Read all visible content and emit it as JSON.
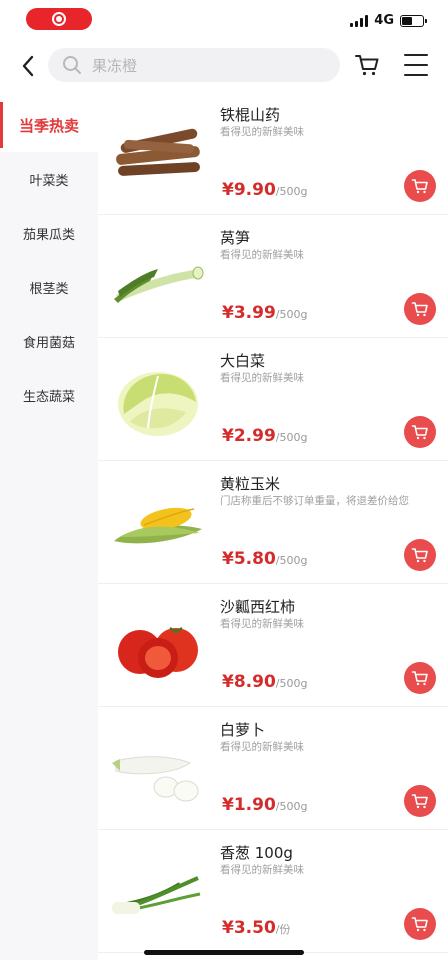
{
  "status_bar": {
    "network": "4G",
    "battery_level": 0.5,
    "colors": {
      "record": "#e8252a"
    }
  },
  "header": {
    "back_icon": "chevron-left-icon",
    "search_placeholder": "果冻橙",
    "cart_icon": "cart-icon",
    "menu_icon": "hamburger-menu-icon"
  },
  "sidebar": {
    "accent_color": "#e23a3a",
    "items": [
      {
        "label": "当季热卖",
        "active": true
      },
      {
        "label": "叶菜类",
        "active": false
      },
      {
        "label": "茄果瓜类",
        "active": false
      },
      {
        "label": "根茎类",
        "active": false
      },
      {
        "label": "食用菌菇",
        "active": false
      },
      {
        "label": "生态蔬菜",
        "active": false
      }
    ]
  },
  "products": [
    {
      "name": "铁棍山药",
      "desc": "看得见的新鲜美味",
      "price": "¥9.90",
      "unit": "/500g",
      "image": "yam"
    },
    {
      "name": "莴笋",
      "desc": "看得见的新鲜美味",
      "price": "¥3.99",
      "unit": "/500g",
      "image": "lettuce-stem"
    },
    {
      "name": "大白菜",
      "desc": "看得见的新鲜美味",
      "price": "¥2.99",
      "unit": "/500g",
      "image": "napa-cabbage"
    },
    {
      "name": "黄粒玉米",
      "desc": "门店称重后不够订单重量，将退差价给您",
      "price": "¥5.80",
      "unit": "/500g",
      "image": "corn"
    },
    {
      "name": "沙瓤西红柿",
      "desc": "看得见的新鲜美味",
      "price": "¥8.90",
      "unit": "/500g",
      "image": "tomato"
    },
    {
      "name": "白萝卜",
      "desc": "看得见的新鲜美味",
      "price": "¥1.90",
      "unit": "/500g",
      "image": "white-radish"
    },
    {
      "name": "香葱 100g",
      "desc": "看得见的新鲜美味",
      "price": "¥3.50",
      "unit": "/份",
      "image": "scallion"
    }
  ],
  "colors": {
    "price": "#d42b2b",
    "cart_button": "#e84c4c"
  }
}
